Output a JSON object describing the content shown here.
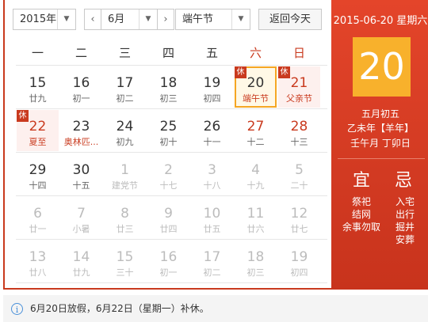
{
  "toolbar": {
    "year": "2015年",
    "month": "6月",
    "holiday": "端午节",
    "prev": "‹",
    "next": "›",
    "today_btn": "返回今天",
    "arrow": "▼"
  },
  "weekdays": [
    "一",
    "二",
    "三",
    "四",
    "五",
    "六",
    "日"
  ],
  "rows": [
    [
      {
        "n": "15",
        "l": "廿九"
      },
      {
        "n": "16",
        "l": "初一"
      },
      {
        "n": "17",
        "l": "初二"
      },
      {
        "n": "18",
        "l": "初三"
      },
      {
        "n": "19",
        "l": "初四"
      },
      {
        "n": "20",
        "l": "端午节",
        "today": true,
        "badge": "休",
        "fest": true,
        "holiday": true
      },
      {
        "n": "21",
        "l": "父亲节",
        "badge": "休",
        "fest": true,
        "holiday": true,
        "weekend": true
      }
    ],
    [
      {
        "n": "22",
        "l": "夏至",
        "badge": "休",
        "fest": true,
        "holiday": true,
        "weekend": true
      },
      {
        "n": "23",
        "l": "奥林匹...",
        "fest": true
      },
      {
        "n": "24",
        "l": "初九"
      },
      {
        "n": "25",
        "l": "初十"
      },
      {
        "n": "26",
        "l": "十一"
      },
      {
        "n": "27",
        "l": "十二",
        "weekend": true
      },
      {
        "n": "28",
        "l": "十三",
        "weekend": true
      }
    ],
    [
      {
        "n": "29",
        "l": "十四"
      },
      {
        "n": "30",
        "l": "十五"
      },
      {
        "n": "1",
        "l": "建党节",
        "dim": true
      },
      {
        "n": "2",
        "l": "十七",
        "dim": true
      },
      {
        "n": "3",
        "l": "十八",
        "dim": true
      },
      {
        "n": "4",
        "l": "十九",
        "dim": true
      },
      {
        "n": "5",
        "l": "二十",
        "dim": true
      }
    ],
    [
      {
        "n": "6",
        "l": "廿一",
        "dim": true
      },
      {
        "n": "7",
        "l": "小暑",
        "dim": true
      },
      {
        "n": "8",
        "l": "廿三",
        "dim": true
      },
      {
        "n": "9",
        "l": "廿四",
        "dim": true
      },
      {
        "n": "10",
        "l": "廿五",
        "dim": true
      },
      {
        "n": "11",
        "l": "廿六",
        "dim": true
      },
      {
        "n": "12",
        "l": "廿七",
        "dim": true
      }
    ],
    [
      {
        "n": "13",
        "l": "廿八",
        "dim": true
      },
      {
        "n": "14",
        "l": "廿九",
        "dim": true
      },
      {
        "n": "15",
        "l": "三十",
        "dim": true
      },
      {
        "n": "16",
        "l": "初一",
        "dim": true
      },
      {
        "n": "17",
        "l": "初二",
        "dim": true
      },
      {
        "n": "18",
        "l": "初三",
        "dim": true
      },
      {
        "n": "19",
        "l": "初四",
        "dim": true
      }
    ]
  ],
  "side": {
    "date": "2015-06-20 星期六",
    "day": "20",
    "lunar": "五月初五",
    "ganzhi_year": "乙未年【羊年】",
    "ganzhi_month": "壬午月 丁卯日",
    "yi": "宜",
    "ji": "忌",
    "yi_items": [
      "祭祀",
      "结网",
      "余事勿取"
    ],
    "ji_items": [
      "入宅",
      "出行",
      "掘井",
      "安葬"
    ]
  },
  "note": {
    "icon": "i",
    "text": "6月20日放假，6月22日（星期一）补休。"
  },
  "colors": {
    "accent": "#c93a1e",
    "today_border": "#f5a623",
    "day_box": "#f8b12c"
  }
}
